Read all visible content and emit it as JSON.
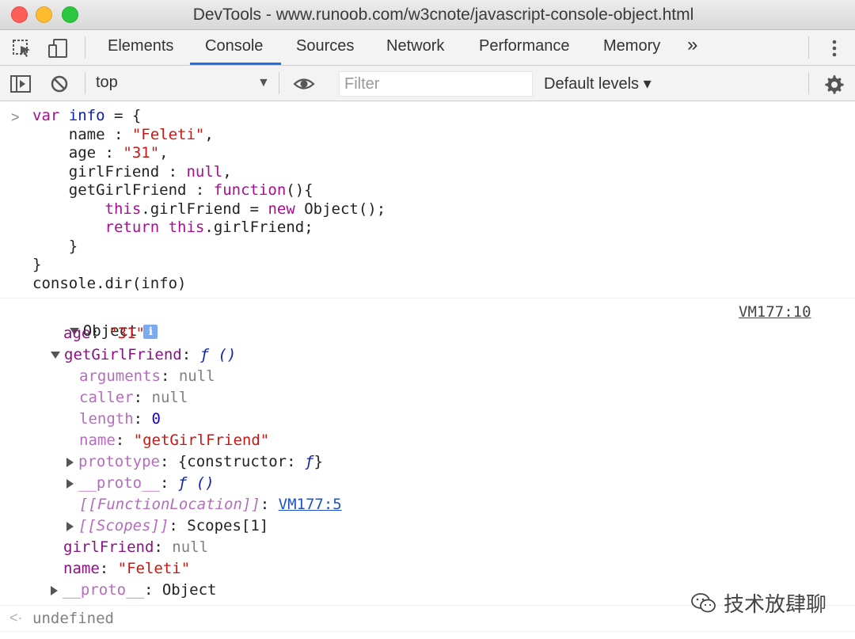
{
  "window": {
    "title": "DevTools - www.runoob.com/w3cnote/javascript-console-object.html"
  },
  "tabs": [
    {
      "label": "Elements"
    },
    {
      "label": "Console"
    },
    {
      "label": "Sources"
    },
    {
      "label": "Network"
    },
    {
      "label": "Performance"
    },
    {
      "label": "Memory"
    }
  ],
  "tabs_overflow": "»",
  "toolbar": {
    "context": "top",
    "filter_placeholder": "Filter",
    "levels": "Default levels ▾"
  },
  "input_code": [
    [
      [
        "kw",
        "var"
      ],
      [
        "t",
        " "
      ],
      [
        "var",
        "info"
      ],
      [
        "t",
        " = {"
      ]
    ],
    [
      [
        "t",
        "    name : "
      ],
      [
        "str",
        "\"Feleti\""
      ],
      [
        "t",
        ","
      ]
    ],
    [
      [
        "t",
        "    age : "
      ],
      [
        "str",
        "\"31\""
      ],
      [
        "t",
        ","
      ]
    ],
    [
      [
        "t",
        "    girlFriend : "
      ],
      [
        "kw",
        "null"
      ],
      [
        "t",
        ","
      ]
    ],
    [
      [
        "t",
        "    getGirlFriend : "
      ],
      [
        "kw",
        "function"
      ],
      [
        "t",
        "(){"
      ]
    ],
    [
      [
        "t",
        "        "
      ],
      [
        "kw",
        "this"
      ],
      [
        "t",
        ".girlFriend = "
      ],
      [
        "kw",
        "new"
      ],
      [
        "t",
        " Object();"
      ]
    ],
    [
      [
        "t",
        "        "
      ],
      [
        "kw",
        "return"
      ],
      [
        "t",
        " "
      ],
      [
        "kw",
        "this"
      ],
      [
        "t",
        ".girlFriend;"
      ]
    ],
    [
      [
        "t",
        "    }"
      ]
    ],
    [
      [
        "t",
        "}"
      ]
    ],
    [
      [
        "t",
        "console.dir(info)"
      ]
    ]
  ],
  "output": {
    "root_label": "Object",
    "source_link": "VM177:10",
    "rows": [
      [
        [
          "key",
          "age"
        ],
        [
          "t",
          ": "
        ],
        [
          "str",
          "\"31\""
        ]
      ],
      [
        [
          "key",
          "getGirlFriend"
        ],
        [
          "t",
          ": "
        ],
        [
          "fn",
          "ƒ ()"
        ]
      ],
      [
        [
          "keydim",
          "arguments"
        ],
        [
          "t",
          ": "
        ],
        [
          "nul",
          "null"
        ]
      ],
      [
        [
          "keydim",
          "caller"
        ],
        [
          "t",
          ": "
        ],
        [
          "nul",
          "null"
        ]
      ],
      [
        [
          "keydim",
          "length"
        ],
        [
          "t",
          ": "
        ],
        [
          "num",
          "0"
        ]
      ],
      [
        [
          "keydim",
          "name"
        ],
        [
          "t",
          ": "
        ],
        [
          "str",
          "\"getGirlFriend\""
        ]
      ],
      [
        [
          "keydim",
          "prototype"
        ],
        [
          "t",
          ": {constructor: "
        ],
        [
          "fn",
          "ƒ"
        ],
        [
          "t",
          "}"
        ]
      ],
      [
        [
          "keydim",
          "__proto__"
        ],
        [
          "t",
          ": "
        ],
        [
          "fn",
          "ƒ ()"
        ]
      ],
      [
        [
          "keydimi",
          "[[FunctionLocation]]"
        ],
        [
          "t",
          ": "
        ],
        [
          "link",
          "VM177:5"
        ]
      ],
      [
        [
          "keydimi",
          "[[Scopes]]"
        ],
        [
          "t",
          ": Scopes[1]"
        ]
      ],
      [
        [
          "key",
          "girlFriend"
        ],
        [
          "t",
          ": "
        ],
        [
          "nul",
          "null"
        ]
      ],
      [
        [
          "key",
          "name"
        ],
        [
          "t",
          ": "
        ],
        [
          "str",
          "\"Feleti\""
        ]
      ],
      [
        [
          "keydim",
          "__proto__"
        ],
        [
          "t",
          ": Object"
        ]
      ]
    ]
  },
  "result": "undefined",
  "watermark": "技术放肆聊",
  "colors": {
    "accent": "#1a73e8",
    "string": "#c41a16",
    "keyword": "#aa0d91"
  }
}
